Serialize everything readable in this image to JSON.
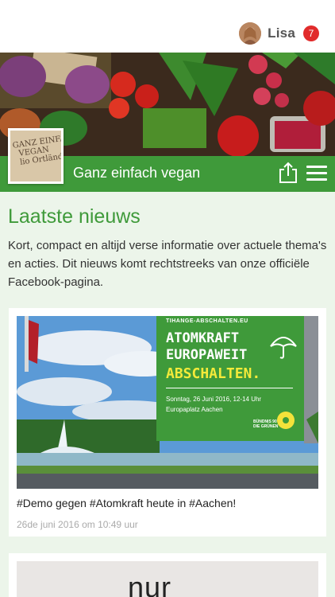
{
  "user": {
    "name": "Lisa",
    "notifications": "7"
  },
  "site": {
    "title": "Ganz einfach vegan",
    "logo_text": "GANZ EINFACH\n  VEGAN\n  lio Ortländer"
  },
  "page": {
    "title": "Laatste nieuws",
    "intro": "Kort, compact en altijd verse informatie over actuele thema's en acties. Dit nieuws komt rechtstreeks van onze officiële Facebook-pagina."
  },
  "posts": [
    {
      "caption": "#Demo gegen #Atomkraft heute in #Aachen!",
      "date": "26de juni 2016 om 10:49 uur",
      "poster": {
        "url": "TIHANGE-ABSCHALTEN.EU",
        "line1": "ATOMKRAFT",
        "line2": "EUROPAWEIT",
        "line3": "ABSCHALTEN.",
        "date": "Sonntag, 26 Juni 2016, 12-14 Uhr",
        "place": "Europaplatz Aachen",
        "brand": "BÜNDNIS 90\nDIE GRÜNEN"
      }
    },
    {
      "image_text": "nur"
    }
  ],
  "colors": {
    "brand_green": "#3f9a3a",
    "badge_red": "#e12b2b",
    "background": "#ecf5ea"
  }
}
